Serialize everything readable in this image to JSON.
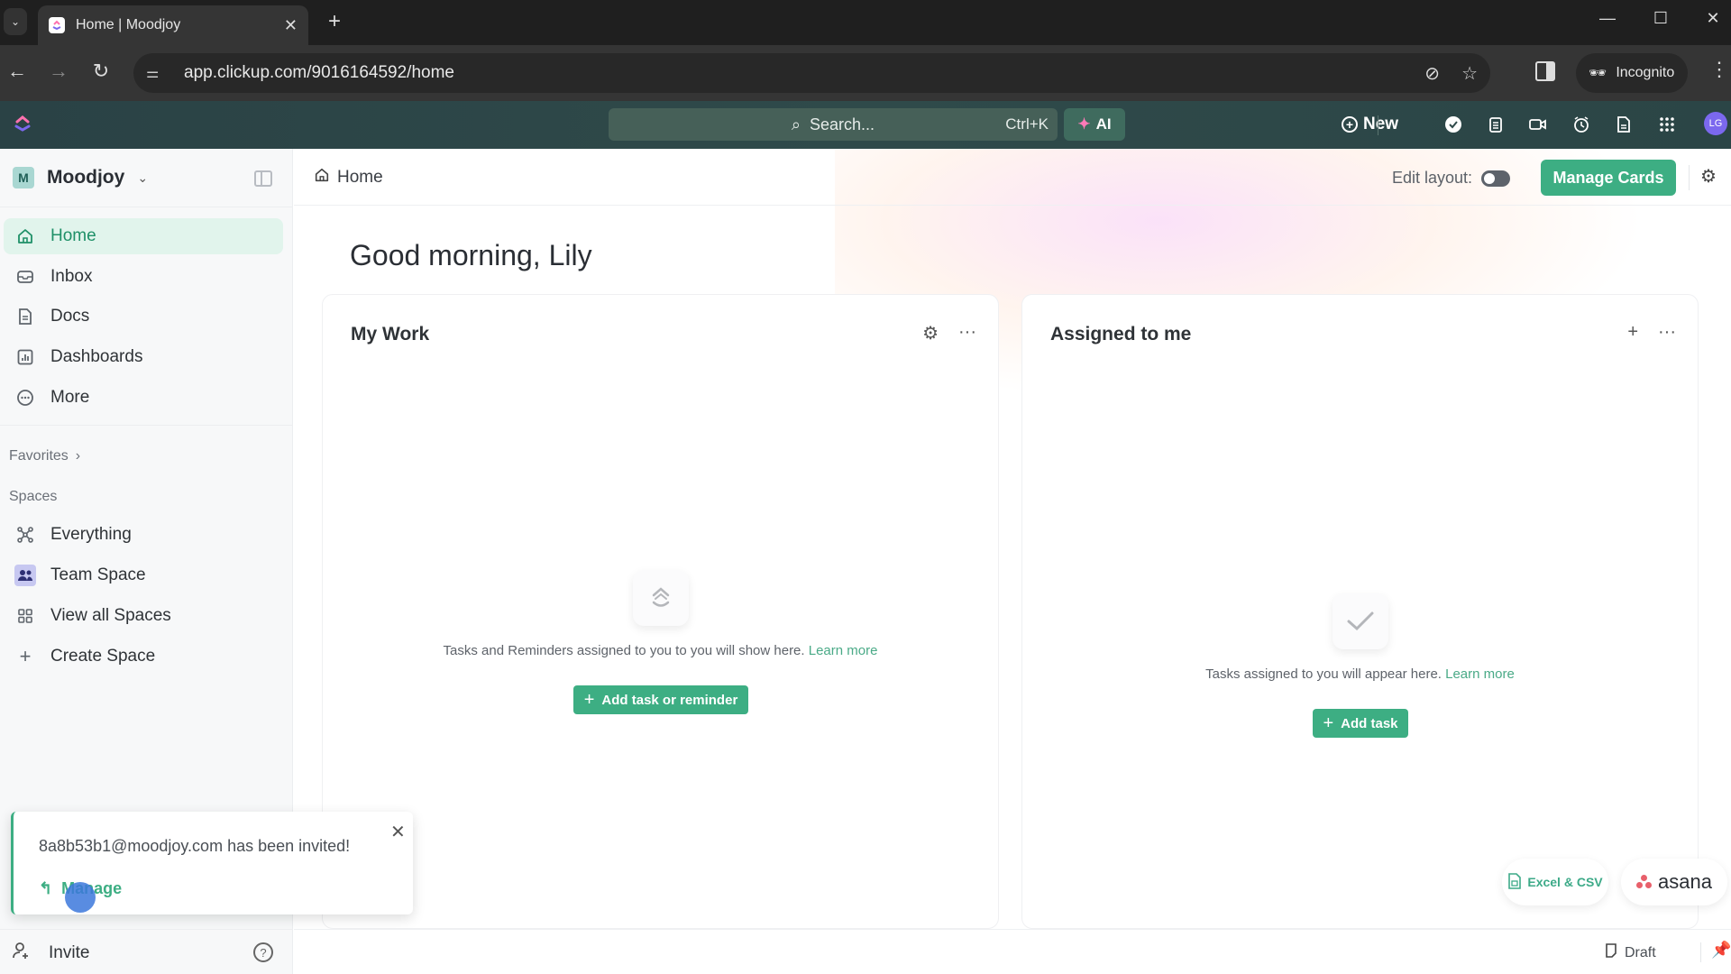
{
  "browser": {
    "tab_title": "Home | Moodjoy",
    "url": "app.clickup.com/9016164592/home",
    "incognito_label": "Incognito",
    "icons": [
      "tab-list-icon",
      "clickup-favicon",
      "close-tab-icon",
      "new-tab-icon",
      "minimize-icon",
      "maximize-icon",
      "close-window-icon",
      "back-icon",
      "forward-icon",
      "reload-icon",
      "site-settings-icon",
      "eye-off-icon",
      "star-icon",
      "side-panel-icon",
      "incognito-icon",
      "menu-icon"
    ]
  },
  "topbar": {
    "search_placeholder": "Search...",
    "search_shortcut": "Ctrl+K",
    "ai_label": "AI",
    "new_label": "New",
    "avatar_initials": "LG",
    "icons": [
      "check-circle-icon",
      "notepad-icon",
      "video-icon",
      "alarm-icon",
      "doc-icon",
      "apps-grid-icon"
    ]
  },
  "sidebar": {
    "workspace_initial": "M",
    "workspace_name": "Moodjoy",
    "nav": [
      {
        "label": "Home",
        "icon": "home-icon",
        "active": true
      },
      {
        "label": "Inbox",
        "icon": "inbox-icon"
      },
      {
        "label": "Docs",
        "icon": "docs-icon"
      },
      {
        "label": "Dashboards",
        "icon": "dashboards-icon"
      },
      {
        "label": "More",
        "icon": "more-icon"
      }
    ],
    "favorites_label": "Favorites",
    "spaces_label": "Spaces",
    "spaces": [
      {
        "label": "Everything",
        "icon": "everything-icon"
      },
      {
        "label": "Team Space",
        "icon": "team-icon"
      },
      {
        "label": "View all Spaces",
        "icon": "grid-icon"
      },
      {
        "label": "Create Space",
        "icon": "plus-icon"
      }
    ],
    "invite_label": "Invite"
  },
  "header": {
    "breadcrumb": "Home",
    "edit_layout_label": "Edit layout:",
    "edit_layout_on": false,
    "manage_cards_label": "Manage Cards"
  },
  "main": {
    "greeting": "Good morning, Lily",
    "cards": [
      {
        "title": "My Work",
        "empty_text": "Tasks and Reminders assigned to you to you will show here.",
        "learn_more": "Learn more",
        "button": "Add task or reminder"
      },
      {
        "title": "Assigned to me",
        "empty_text": "Tasks assigned to you will appear here.",
        "learn_more": "Learn more",
        "button": "Add task"
      }
    ],
    "imports": {
      "excel": "Excel & CSV",
      "asana": "asana"
    }
  },
  "bottombar": {
    "draft_label": "Draft"
  },
  "toast": {
    "message": "8a8b53b1@moodjoy.com has been invited!",
    "action": "Manage"
  },
  "colors": {
    "brand_green": "#3dae83",
    "topbar": "#2f4a4a",
    "active_nav_bg": "#e1f4ec"
  }
}
